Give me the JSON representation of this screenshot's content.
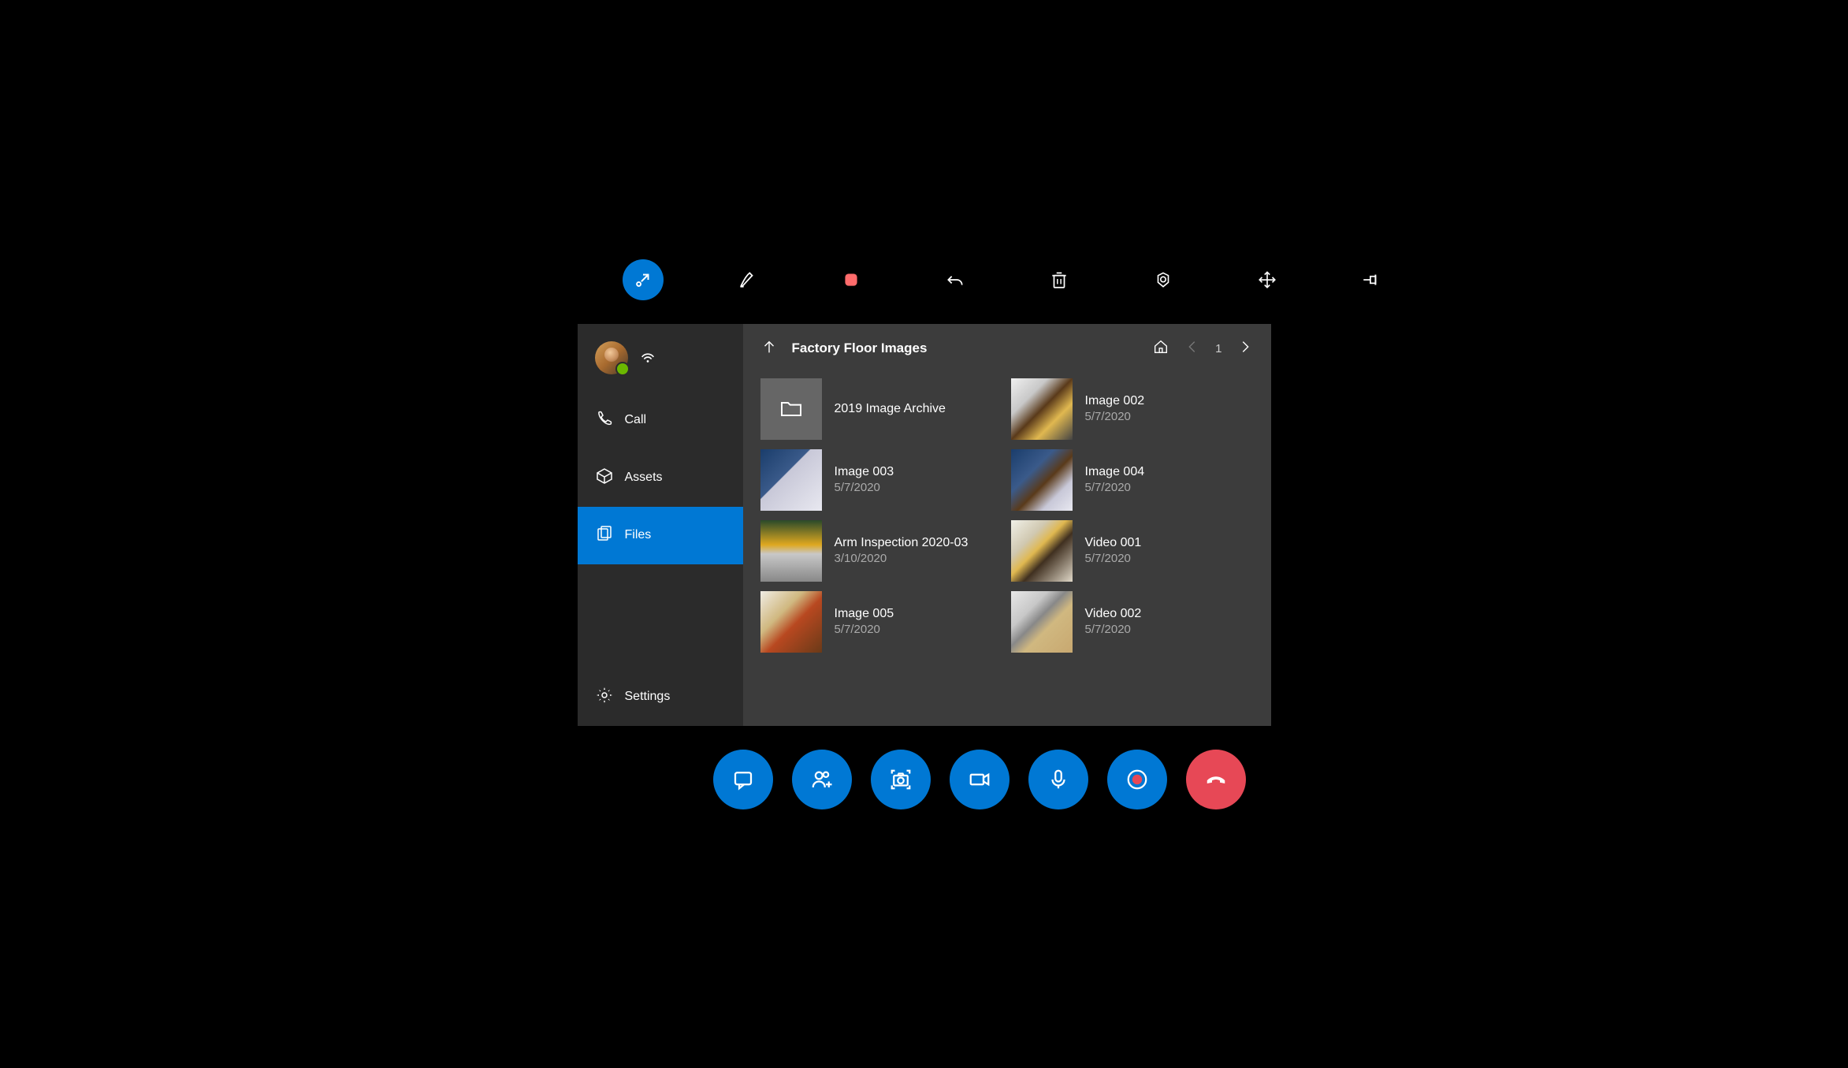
{
  "sidebar": {
    "items": [
      {
        "label": "Call"
      },
      {
        "label": "Assets"
      },
      {
        "label": "Files"
      },
      {
        "label": "Settings"
      }
    ]
  },
  "content": {
    "title": "Factory Floor Images",
    "page": "1"
  },
  "files": [
    {
      "name": "2019 Image Archive",
      "date": ""
    },
    {
      "name": "Image 003",
      "date": "5/7/2020"
    },
    {
      "name": "Arm Inspection 2020-03",
      "date": "3/10/2020"
    },
    {
      "name": "Image 005",
      "date": "5/7/2020"
    },
    {
      "name": "Image 002",
      "date": "5/7/2020"
    },
    {
      "name": "Image 004",
      "date": "5/7/2020"
    },
    {
      "name": "Video 001",
      "date": "5/7/2020"
    },
    {
      "name": "Video 002",
      "date": "5/7/2020"
    }
  ]
}
